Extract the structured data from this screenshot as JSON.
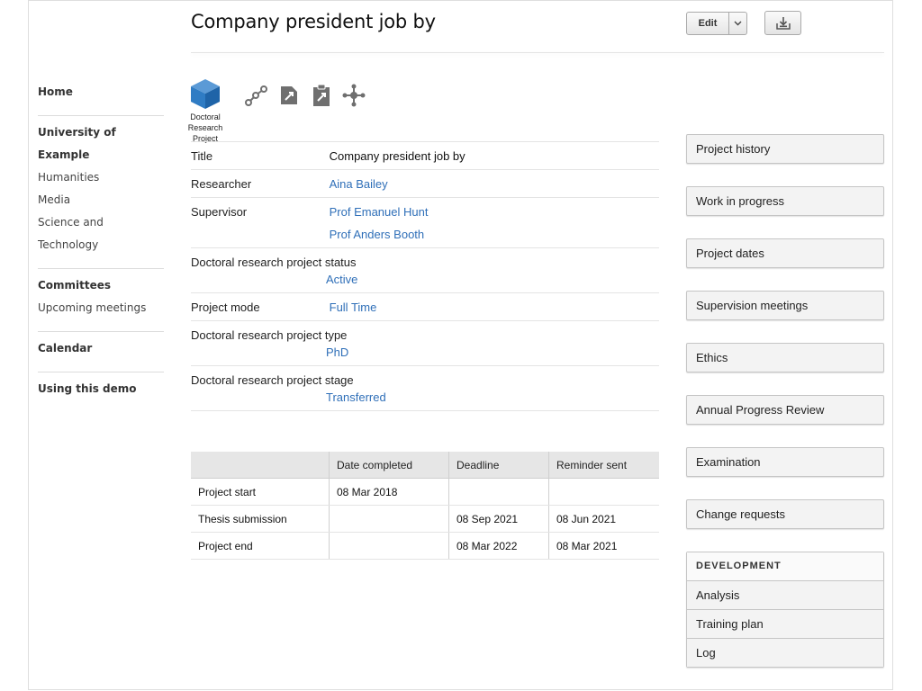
{
  "header": {
    "title": "Company president job by",
    "edit_label": "Edit"
  },
  "sidebar": {
    "groups": [
      {
        "heading": "Home",
        "items": []
      },
      {
        "heading": "University of Example",
        "items": [
          "Humanities",
          "Media",
          "Science and Technology"
        ]
      },
      {
        "heading": "Committees",
        "items": [
          "Upcoming meetings"
        ]
      },
      {
        "heading": "Calendar",
        "items": []
      },
      {
        "heading": "Using this demo",
        "items": []
      }
    ]
  },
  "object_icon": {
    "label_line1": "Doctoral",
    "label_line2": "Research",
    "label_line3": "Project",
    "color": "#2f7cc4"
  },
  "toolbar_icons": [
    "network-icon",
    "edit-document-icon",
    "clipboard-icon",
    "hierarchy-icon"
  ],
  "details": {
    "title_label": "Title",
    "title_value": "Company president job by",
    "researcher_label": "Researcher",
    "researcher_value": "Aina Bailey",
    "supervisor_label": "Supervisor",
    "supervisors": [
      "Prof Emanuel Hunt",
      "Prof Anders Booth"
    ],
    "status_label": "Doctoral research project status",
    "status_value": "Active",
    "mode_label": "Project mode",
    "mode_value": "Full Time",
    "type_label": "Doctoral research project type",
    "type_value": "PhD",
    "stage_label": "Doctoral research project stage",
    "stage_value": "Transferred"
  },
  "dates_table": {
    "headers": [
      "",
      "Date completed",
      "Deadline",
      "Reminder sent"
    ],
    "rows": [
      [
        "Project start",
        "08 Mar 2018",
        "",
        ""
      ],
      [
        "Thesis submission",
        "",
        "08 Sep 2021",
        "08 Jun 2021"
      ],
      [
        "Project end",
        "",
        "08 Mar 2022",
        "08 Mar 2021"
      ]
    ]
  },
  "right_nav": {
    "buttons": [
      "Project history",
      "Work in progress",
      "Project dates",
      "Supervision meetings",
      "Ethics",
      "Annual Progress Review",
      "Examination",
      "Change requests"
    ],
    "development_heading": "DEVELOPMENT",
    "development_items": [
      "Analysis",
      "Training plan",
      "Log"
    ]
  },
  "colors": {
    "link": "#2f6fb8",
    "icon_grey": "#6f6f6f"
  }
}
